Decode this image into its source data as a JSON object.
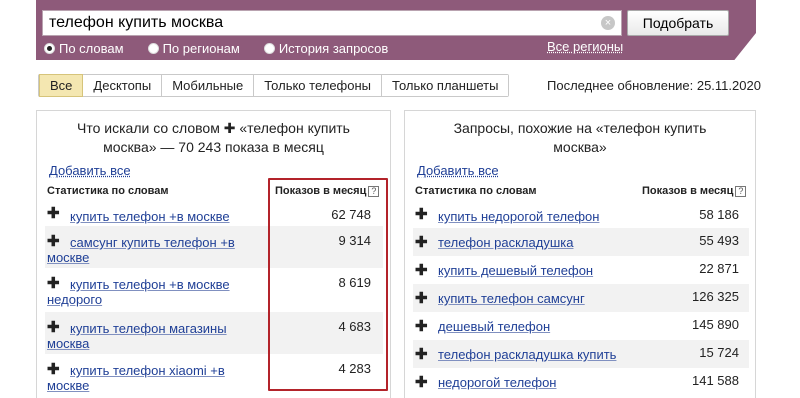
{
  "search": {
    "query": "телефон купить москва",
    "clear_icon": "×",
    "submit_label": "Подобрать"
  },
  "modes": [
    {
      "label": "По словам",
      "checked": true
    },
    {
      "label": "По регионам",
      "checked": false
    },
    {
      "label": "История запросов",
      "checked": false
    }
  ],
  "all_regions_label": "Все регионы",
  "tabs": [
    "Все",
    "Десктопы",
    "Мобильные",
    "Только телефоны",
    "Только планшеты"
  ],
  "last_update": "Последнее обновление: 25.11.2020",
  "left": {
    "title": "Что искали со словом  ✚ «телефон купить москва» — 70 243 показа в месяц",
    "add_all": "Добавить все",
    "col_words": "Статистика по словам",
    "col_count": "Показов в месяц",
    "rows": [
      {
        "phrase": "купить телефон +в москве",
        "count": "62 748"
      },
      {
        "phrase": "самсунг купить телефон +в москве",
        "count": "9 314"
      },
      {
        "phrase": "купить телефон +в москве недорого",
        "count": "8 619"
      },
      {
        "phrase": "купить телефон магазины москва",
        "count": "4 683"
      },
      {
        "phrase": "купить телефон xiaomi +в москве",
        "count": "4 283"
      }
    ]
  },
  "right": {
    "title": "Запросы, похожие на «телефон купить москва»",
    "add_all": "Добавить все",
    "col_words": "Статистика по словам",
    "col_count": "Показов в месяц",
    "rows": [
      {
        "phrase": "купить недорогой телефон",
        "count": "58 186"
      },
      {
        "phrase": "телефон раскладушка",
        "count": "55 493"
      },
      {
        "phrase": "купить дешевый телефон",
        "count": "22 871"
      },
      {
        "phrase": "купить телефон самсунг",
        "count": "126 325"
      },
      {
        "phrase": "дешевый телефон",
        "count": "145 890"
      },
      {
        "phrase": "телефон раскладушка купить",
        "count": "15 724"
      },
      {
        "phrase": "недорогой телефон",
        "count": "141 588"
      }
    ]
  },
  "help_icon": "?",
  "plus_icon": "✚"
}
